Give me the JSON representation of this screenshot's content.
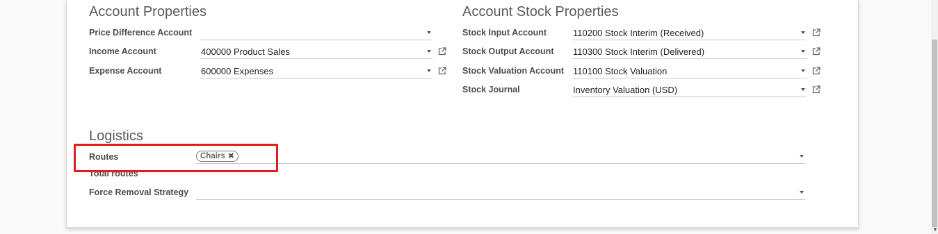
{
  "account_properties": {
    "title": "Account Properties",
    "fields": [
      {
        "label": "Price Difference Account",
        "value": ""
      },
      {
        "label": "Income Account",
        "value": "400000 Product Sales"
      },
      {
        "label": "Expense Account",
        "value": "600000 Expenses"
      }
    ]
  },
  "stock_properties": {
    "title": "Account Stock Properties",
    "fields": [
      {
        "label": "Stock Input Account",
        "value": "110200 Stock Interim (Received)"
      },
      {
        "label": "Stock Output Account",
        "value": "110300 Stock Interim (Delivered)"
      },
      {
        "label": "Stock Valuation Account",
        "value": "110100 Stock Valuation"
      },
      {
        "label": "Stock Journal",
        "value": "Inventory Valuation (USD)"
      }
    ]
  },
  "logistics": {
    "title": "Logistics",
    "routes_label": "Routes",
    "routes_tags": [
      "Chairs"
    ],
    "tag_remove_glyph": "✖",
    "total_routes_label": "Total routes",
    "force_removal_label": "Force Removal Strategy",
    "force_removal_value": ""
  },
  "icons": {
    "external_link": "external-link-icon",
    "dropdown": "caret-down-icon"
  },
  "colors": {
    "highlight": "#e01e1e"
  }
}
